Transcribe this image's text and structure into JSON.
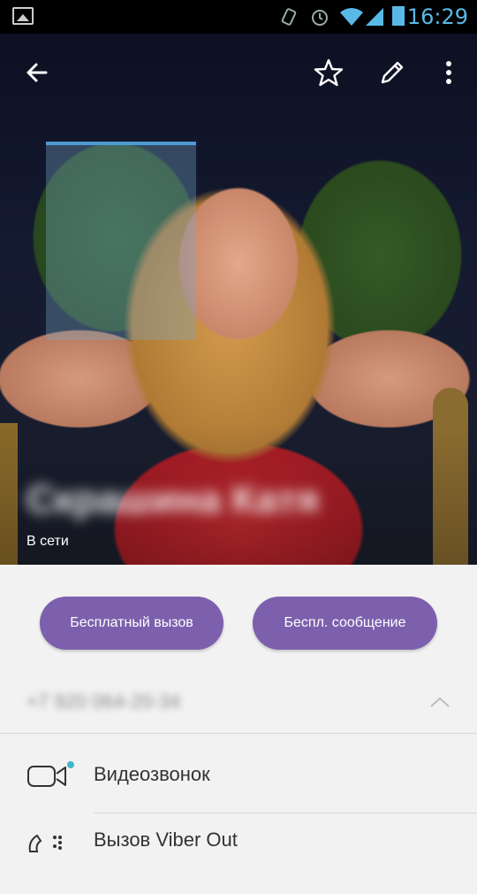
{
  "status_bar": {
    "time": "16:29",
    "icons": [
      "gallery-icon",
      "vibrate-icon",
      "alarm-icon",
      "wifi-icon",
      "signal-icon",
      "battery-icon"
    ]
  },
  "header": {
    "back_icon": "back-arrow-icon",
    "favorite_icon": "star-icon",
    "edit_icon": "pencil-icon",
    "more_icon": "more-vert-icon"
  },
  "profile": {
    "name": "Скрашина Катя",
    "status": "В сети"
  },
  "actions": {
    "free_call_label": "Бесплатный вызов",
    "free_message_label": "Беспл. сообщение",
    "accent": "#7c60ad"
  },
  "phone": {
    "number": "+7 920 064-20-34"
  },
  "menu": {
    "items": [
      {
        "label": "Видеозвонок",
        "icon": "video-camera-icon"
      },
      {
        "label": "Вызов Viber Out",
        "icon": "viber-out-icon"
      }
    ]
  }
}
